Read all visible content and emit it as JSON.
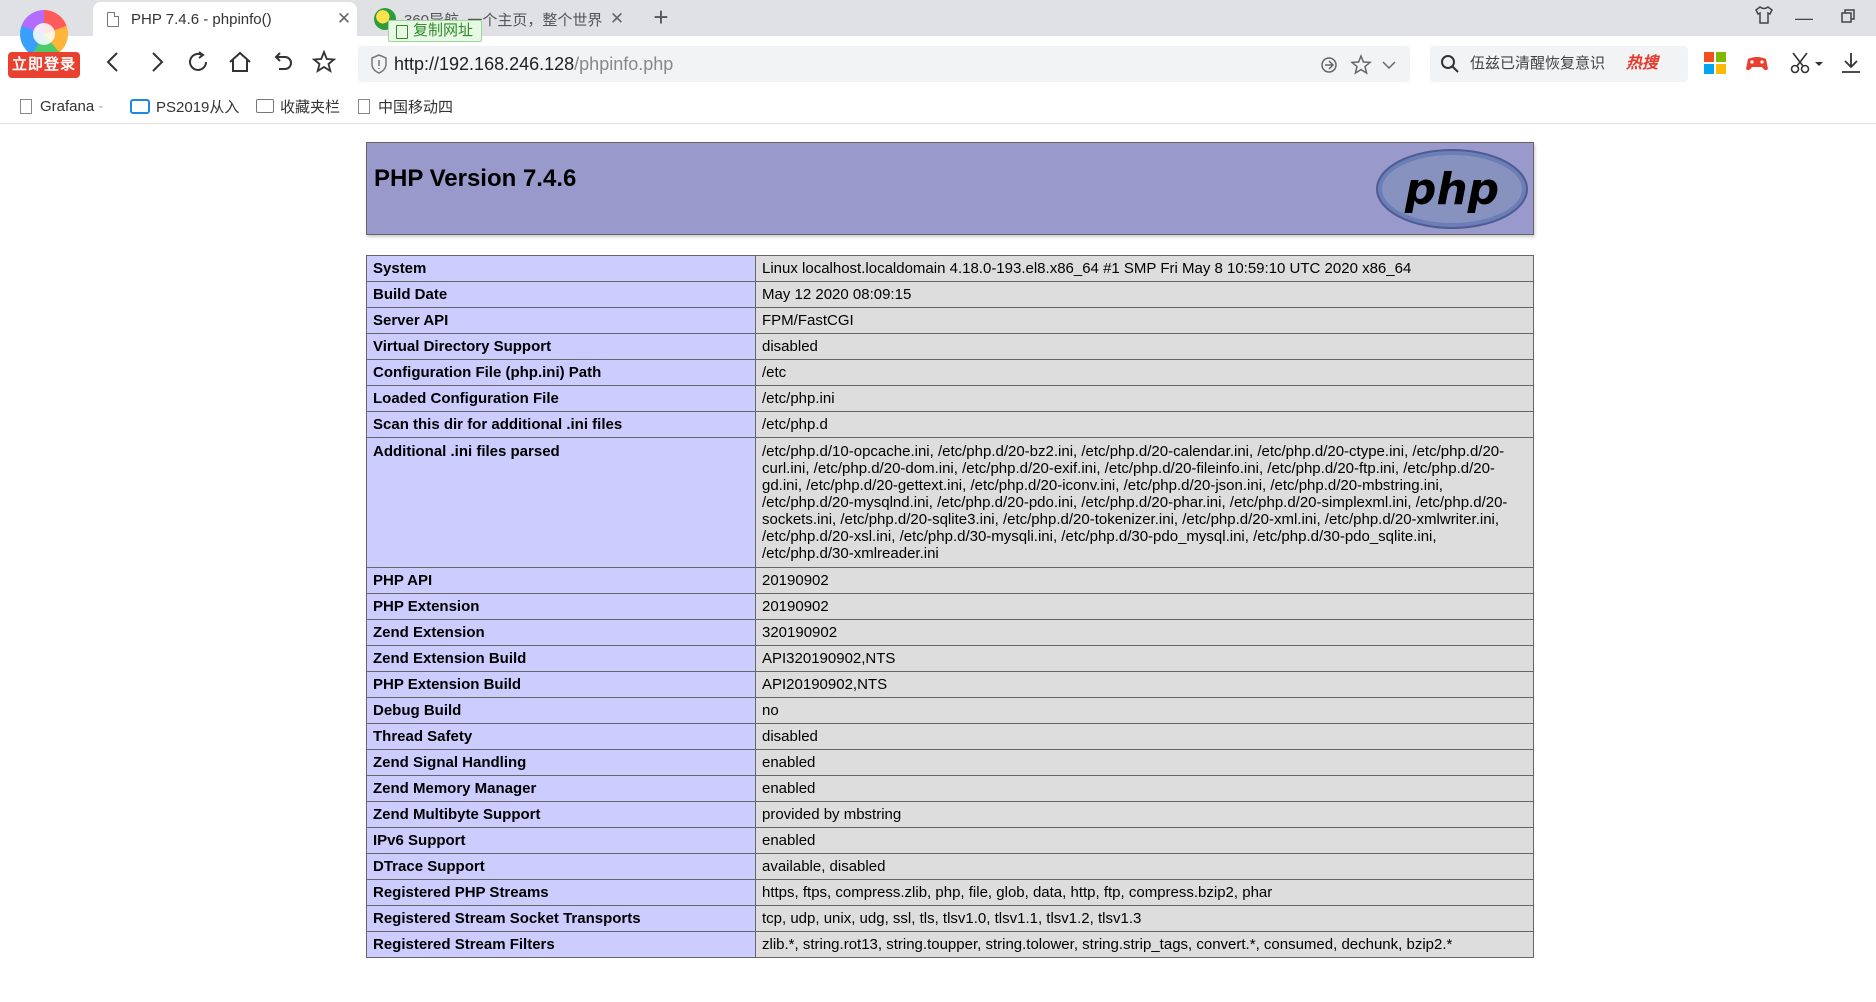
{
  "browser": {
    "login_badge": "立即登录",
    "active_tab": {
      "title": "PHP 7.4.6 - phpinfo()"
    },
    "inactive_tab": {
      "title": "360导航_一个主页，整个世界"
    },
    "copy_url_label": "复制网址",
    "address": {
      "scheme_host": "http://192.168.246.128",
      "path": "/phpinfo.php"
    },
    "search": {
      "text": "伍兹已清醒恢复意识",
      "hot_label": "热搜"
    },
    "bookmarks": [
      {
        "label": "Grafana",
        "icon": "doc-icon"
      },
      {
        "label": "PS2019从入",
        "icon": "tv-icon"
      },
      {
        "label": "收藏夹栏",
        "icon": "folder-icon"
      },
      {
        "label": "中国移动四",
        "icon": "doc-icon"
      }
    ],
    "accent_color": "#e8412f"
  },
  "phpinfo": {
    "header_title": "PHP Version 7.4.6",
    "logo_text": "php",
    "rows": [
      {
        "label": "System",
        "value": "Linux localhost.localdomain 4.18.0-193.el8.x86_64 #1 SMP Fri May 8 10:59:10 UTC 2020 x86_64"
      },
      {
        "label": "Build Date",
        "value": "May 12 2020 08:09:15"
      },
      {
        "label": "Server API",
        "value": "FPM/FastCGI"
      },
      {
        "label": "Virtual Directory Support",
        "value": "disabled"
      },
      {
        "label": "Configuration File (php.ini) Path",
        "value": "/etc"
      },
      {
        "label": "Loaded Configuration File",
        "value": "/etc/php.ini"
      },
      {
        "label": "Scan this dir for additional .ini files",
        "value": "/etc/php.d"
      },
      {
        "label": "Additional .ini files parsed",
        "value": "/etc/php.d/10-opcache.ini, /etc/php.d/20-bz2.ini, /etc/php.d/20-calendar.ini, /etc/php.d/20-ctype.ini, /etc/php.d/20-curl.ini, /etc/php.d/20-dom.ini, /etc/php.d/20-exif.ini, /etc/php.d/20-fileinfo.ini, /etc/php.d/20-ftp.ini, /etc/php.d/20-gd.ini, /etc/php.d/20-gettext.ini, /etc/php.d/20-iconv.ini, /etc/php.d/20-json.ini, /etc/php.d/20-mbstring.ini, /etc/php.d/20-mysqlnd.ini, /etc/php.d/20-pdo.ini, /etc/php.d/20-phar.ini, /etc/php.d/20-simplexml.ini, /etc/php.d/20-sockets.ini, /etc/php.d/20-sqlite3.ini, /etc/php.d/20-tokenizer.ini, /etc/php.d/20-xml.ini, /etc/php.d/20-xmlwriter.ini, /etc/php.d/20-xsl.ini, /etc/php.d/30-mysqli.ini, /etc/php.d/30-pdo_mysql.ini, /etc/php.d/30-pdo_sqlite.ini, /etc/php.d/30-xmlreader.ini"
      },
      {
        "label": "PHP API",
        "value": "20190902"
      },
      {
        "label": "PHP Extension",
        "value": "20190902"
      },
      {
        "label": "Zend Extension",
        "value": "320190902"
      },
      {
        "label": "Zend Extension Build",
        "value": "API320190902,NTS"
      },
      {
        "label": "PHP Extension Build",
        "value": "API20190902,NTS"
      },
      {
        "label": "Debug Build",
        "value": "no"
      },
      {
        "label": "Thread Safety",
        "value": "disabled"
      },
      {
        "label": "Zend Signal Handling",
        "value": "enabled"
      },
      {
        "label": "Zend Memory Manager",
        "value": "enabled"
      },
      {
        "label": "Zend Multibyte Support",
        "value": "provided by mbstring"
      },
      {
        "label": "IPv6 Support",
        "value": "enabled"
      },
      {
        "label": "DTrace Support",
        "value": "available, disabled"
      },
      {
        "label": "Registered PHP Streams",
        "value": "https, ftps, compress.zlib, php, file, glob, data, http, ftp, compress.bzip2, phar"
      },
      {
        "label": "Registered Stream Socket Transports",
        "value": "tcp, udp, unix, udg, ssl, tls, tlsv1.0, tlsv1.1, tlsv1.2, tlsv1.3"
      },
      {
        "label": "Registered Stream Filters",
        "value": "zlib.*, string.rot13, string.toupper, string.tolower, string.strip_tags, convert.*, consumed, dechunk, bzip2.*"
      }
    ],
    "colors": {
      "header_bg": "#9999cc",
      "label_bg": "#ccccff",
      "value_bg": "#dddddd"
    }
  }
}
